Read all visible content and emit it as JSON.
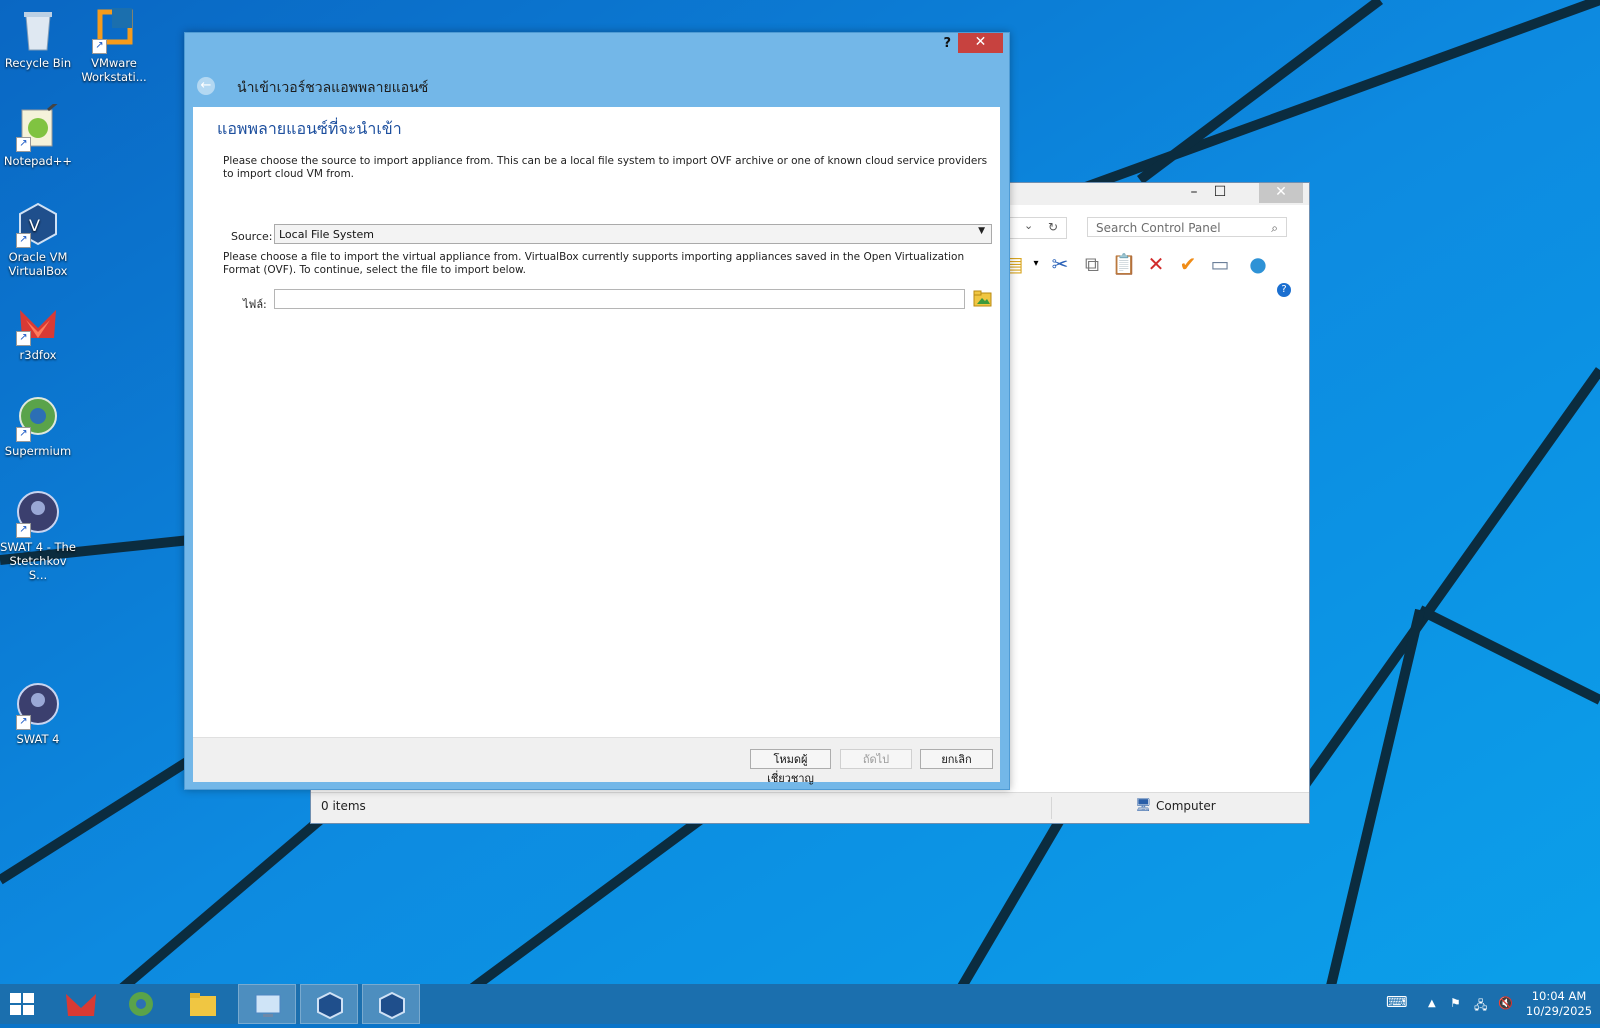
{
  "desktop": {
    "icons": [
      {
        "label": "Recycle Bin"
      },
      {
        "label": "VMware Workstati..."
      },
      {
        "label": "Notepad++"
      },
      {
        "label": "Oracle VM VirtualBox"
      },
      {
        "label": "r3dfox"
      },
      {
        "label": "Supermium"
      },
      {
        "label": "SWAT 4 - The Stetchkov S..."
      },
      {
        "label": "SWAT 4"
      }
    ]
  },
  "control_panel": {
    "help_button": "?",
    "search_placeholder": "Search Control Panel",
    "status_items": "0 items",
    "status_location": "Computer"
  },
  "vbox_dialog": {
    "help": "?",
    "close": "✕",
    "title": "นำเข้าเวอร์ชวลแอพพลายแอนซ์",
    "heading": "แอพพลายแอนซ์ที่จะนำเข้า",
    "source_text": "Please choose the source to import appliance from. This can be a local file system to import OVF archive or one of known cloud service providers to import cloud VM from.",
    "source_label": "Source:",
    "source_value": "Local File System",
    "file_text": "Please choose a file to import the virtual appliance from. VirtualBox currently supports importing appliances saved in the Open Virtualization Format (OVF). To continue, select the file to import below.",
    "file_label": "ไฟล์:",
    "file_value": "",
    "buttons": {
      "expert": "โหมดผู้เชี่ยวชาญ",
      "next": "ถัดไป",
      "cancel": "ยกเลิก"
    }
  },
  "taskbar": {
    "time": "10:04 AM",
    "date": "10/29/2025"
  },
  "colors": {
    "wallpaper": "#0a74c9",
    "dialog_frame": "#73b7e8",
    "heading": "#1d4f9e",
    "close": "#c7423f"
  }
}
